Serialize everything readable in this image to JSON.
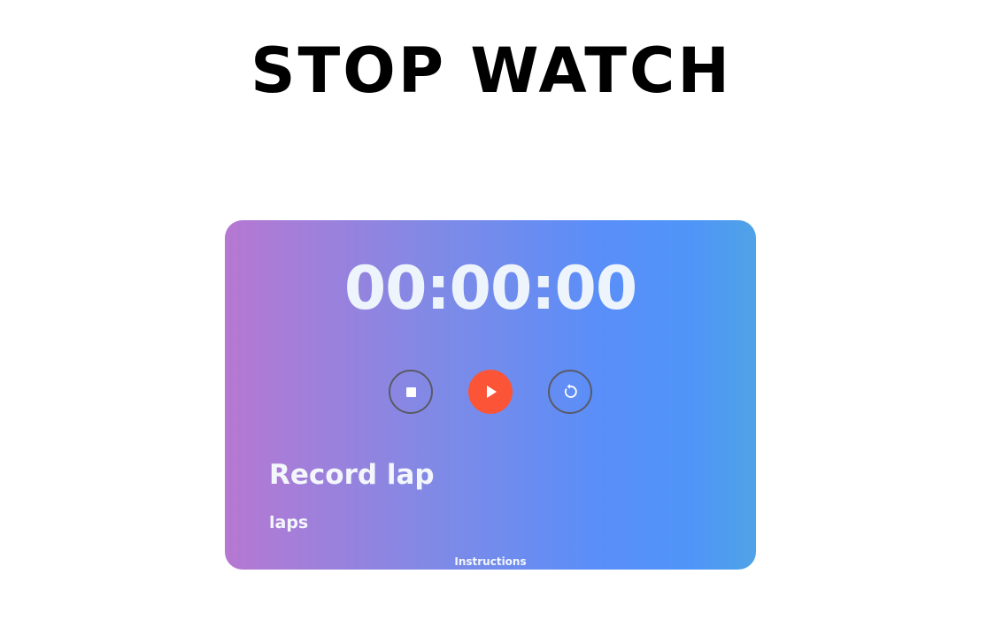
{
  "page": {
    "title": "STOP WATCH"
  },
  "stopwatch": {
    "display": "00:00:00",
    "controls": {
      "stop_icon": "stop-icon",
      "play_icon": "play-icon",
      "reset_icon": "reset-icon"
    },
    "colors": {
      "play_button": "#fc5436",
      "outline_button": "#5a5a66",
      "gradient_start": "#b678d2",
      "gradient_mid": "#5a8ef8",
      "gradient_end": "#4fa3e6"
    },
    "record_lap_label": "Record lap",
    "laps_label": "laps",
    "instructions_label": "Instructions"
  }
}
